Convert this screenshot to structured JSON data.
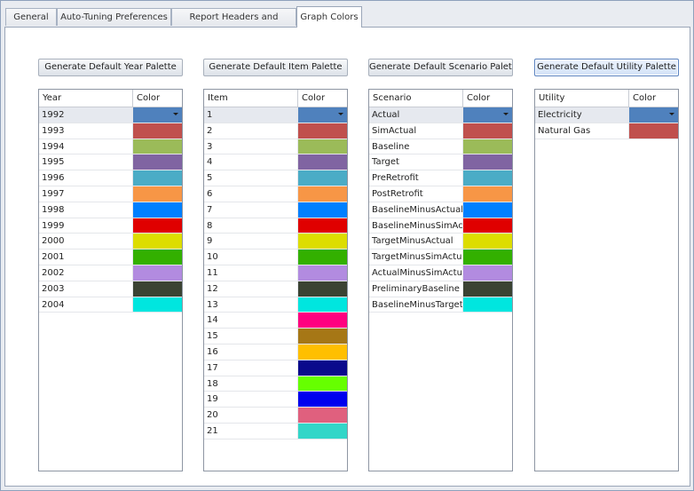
{
  "tabs": [
    {
      "label": "General"
    },
    {
      "label": "Auto-Tuning Preferences"
    },
    {
      "label": "Report Headers and Footers"
    },
    {
      "label": "Graph Colors"
    }
  ],
  "buttons": {
    "year": "Generate Default Year Palette",
    "item": "Generate Default Item Palette",
    "scenario": "Generate Default Scenario Palette",
    "utility": "Generate Default Utility Palette"
  },
  "grids": {
    "year": {
      "col1": "Year",
      "col2": "Color",
      "rows": [
        {
          "name": "1992",
          "color": "#4f81bd"
        },
        {
          "name": "1993",
          "color": "#c0504d"
        },
        {
          "name": "1994",
          "color": "#9bbb59"
        },
        {
          "name": "1995",
          "color": "#8064a2"
        },
        {
          "name": "1996",
          "color": "#4bacc6"
        },
        {
          "name": "1997",
          "color": "#f79646"
        },
        {
          "name": "1998",
          "color": "#0080ff"
        },
        {
          "name": "1999",
          "color": "#e00000"
        },
        {
          "name": "2000",
          "color": "#dddd00"
        },
        {
          "name": "2001",
          "color": "#33b000"
        },
        {
          "name": "2002",
          "color": "#b28be0"
        },
        {
          "name": "2003",
          "color": "#3b4333"
        },
        {
          "name": "2004",
          "color": "#00e6df"
        }
      ]
    },
    "item": {
      "col1": "Item",
      "col2": "Color",
      "rows": [
        {
          "name": "1",
          "color": "#4f81bd"
        },
        {
          "name": "2",
          "color": "#c0504d"
        },
        {
          "name": "3",
          "color": "#9bbb59"
        },
        {
          "name": "4",
          "color": "#8064a2"
        },
        {
          "name": "5",
          "color": "#4bacc6"
        },
        {
          "name": "6",
          "color": "#f79646"
        },
        {
          "name": "7",
          "color": "#0080ff"
        },
        {
          "name": "8",
          "color": "#e00000"
        },
        {
          "name": "9",
          "color": "#dddd00"
        },
        {
          "name": "10",
          "color": "#33b000"
        },
        {
          "name": "11",
          "color": "#b28be0"
        },
        {
          "name": "12",
          "color": "#3b4333"
        },
        {
          "name": "13",
          "color": "#00e6df"
        },
        {
          "name": "14",
          "color": "#ff0080"
        },
        {
          "name": "15",
          "color": "#a67716"
        },
        {
          "name": "16",
          "color": "#ffbf00"
        },
        {
          "name": "17",
          "color": "#0a0a8c"
        },
        {
          "name": "18",
          "color": "#66ff00"
        },
        {
          "name": "19",
          "color": "#0000ee"
        },
        {
          "name": "20",
          "color": "#e0607e"
        },
        {
          "name": "21",
          "color": "#33d6c8"
        }
      ]
    },
    "scenario": {
      "col1": "Scenario",
      "col2": "Color",
      "rows": [
        {
          "name": "Actual",
          "color": "#4f81bd"
        },
        {
          "name": "SimActual",
          "color": "#c0504d"
        },
        {
          "name": "Baseline",
          "color": "#9bbb59"
        },
        {
          "name": "Target",
          "color": "#8064a2"
        },
        {
          "name": "PreRetrofit",
          "color": "#4bacc6"
        },
        {
          "name": "PostRetrofit",
          "color": "#f79646"
        },
        {
          "name": "BaselineMinusActual",
          "color": "#0080ff"
        },
        {
          "name": "BaselineMinusSimAct...",
          "color": "#e00000"
        },
        {
          "name": "TargetMinusActual",
          "color": "#dddd00"
        },
        {
          "name": "TargetMinusSimActual",
          "color": "#33b000"
        },
        {
          "name": "ActualMinusSimActual",
          "color": "#b28be0"
        },
        {
          "name": "PreliminaryBaseline",
          "color": "#3b4333"
        },
        {
          "name": "BaselineMinusTarget",
          "color": "#00e6df"
        }
      ]
    },
    "utility": {
      "col1": "Utility",
      "col2": "Color",
      "rows": [
        {
          "name": "Electricity",
          "color": "#4f81bd"
        },
        {
          "name": "Natural Gas",
          "color": "#c0504d"
        }
      ]
    }
  }
}
